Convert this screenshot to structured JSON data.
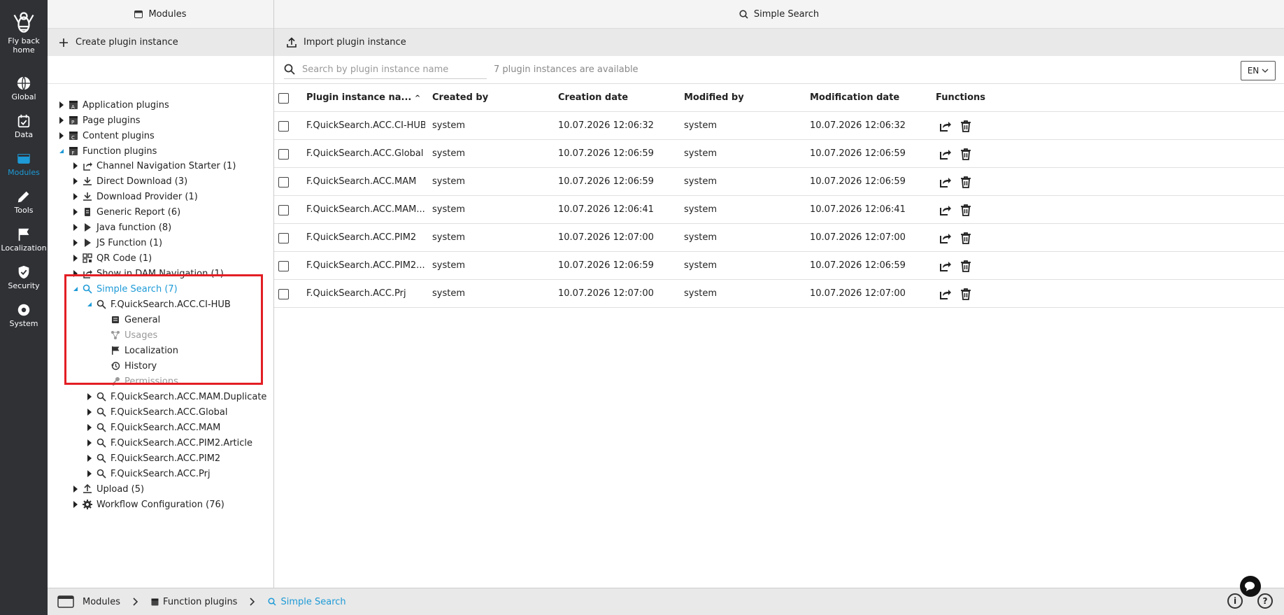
{
  "rail": {
    "home": "Fly back home",
    "items": [
      {
        "label": "Global",
        "icon": "globe-icon"
      },
      {
        "label": "Data",
        "icon": "data-icon"
      },
      {
        "label": "Modules",
        "icon": "modules-icon"
      },
      {
        "label": "Tools",
        "icon": "pencil-icon"
      },
      {
        "label": "Localization",
        "icon": "flag-icon"
      },
      {
        "label": "Security",
        "icon": "shield-icon"
      },
      {
        "label": "System",
        "icon": "gear-icon"
      }
    ]
  },
  "left_header": {
    "title": "Modules",
    "action": "Create plugin instance"
  },
  "right_header": {
    "title": "Simple Search",
    "action": "Import plugin instance"
  },
  "search": {
    "placeholder": "Search by plugin instance name",
    "count": "7 plugin instances are available",
    "lang": "EN"
  },
  "tree": {
    "top": [
      "Application plugins",
      "Page plugins",
      "Content plugins",
      "Function plugins"
    ],
    "function_children": [
      "Channel Navigation Starter (1)",
      "Direct Download (3)",
      "Download Provider (1)",
      "Generic Report (6)",
      "Java function (8)",
      "JS Function (1)",
      "QR Code (1)",
      "Show in DAM Navigation (1)",
      "Simple Search (7)"
    ],
    "expanded_instance": "F.QuickSearch.ACC.CI-HUB",
    "instance_children": [
      "General",
      "Usages",
      "Localization",
      "History",
      "Permissions"
    ],
    "other_instances": [
      "F.QuickSearch.ACC.MAM.Duplicate",
      "F.QuickSearch.ACC.Global",
      "F.QuickSearch.ACC.MAM",
      "F.QuickSearch.ACC.PIM2.Article",
      "F.QuickSearch.ACC.PIM2",
      "F.QuickSearch.ACC.Prj"
    ],
    "after": [
      "Upload (5)",
      "Workflow Configuration (76)"
    ]
  },
  "table": {
    "headers": [
      "Plugin instance na...",
      "Created by",
      "Creation date",
      "Modified by",
      "Modification date",
      "Functions"
    ],
    "sort_indicator": "^",
    "rows": [
      [
        "F.QuickSearch.ACC.CI-HUB",
        "system",
        "10.07.2026 12:06:32",
        "system",
        "10.07.2026 12:06:32"
      ],
      [
        "F.QuickSearch.ACC.Global",
        "system",
        "10.07.2026 12:06:59",
        "system",
        "10.07.2026 12:06:59"
      ],
      [
        "F.QuickSearch.ACC.MAM",
        "system",
        "10.07.2026 12:06:59",
        "system",
        "10.07.2026 12:06:59"
      ],
      [
        "F.QuickSearch.ACC.MAM....",
        "system",
        "10.07.2026 12:06:41",
        "system",
        "10.07.2026 12:06:41"
      ],
      [
        "F.QuickSearch.ACC.PIM2",
        "system",
        "10.07.2026 12:07:00",
        "system",
        "10.07.2026 12:07:00"
      ],
      [
        "F.QuickSearch.ACC.PIM2....",
        "system",
        "10.07.2026 12:06:59",
        "system",
        "10.07.2026 12:06:59"
      ],
      [
        "F.QuickSearch.ACC.Prj",
        "system",
        "10.07.2026 12:07:00",
        "system",
        "10.07.2026 12:07:00"
      ]
    ]
  },
  "breadcrumb": [
    "Modules",
    "Function plugins",
    "Simple Search"
  ],
  "colors": {
    "accent": "#1e9ad6",
    "rail_bg": "#2f3135",
    "highlight": "#e31e24"
  }
}
